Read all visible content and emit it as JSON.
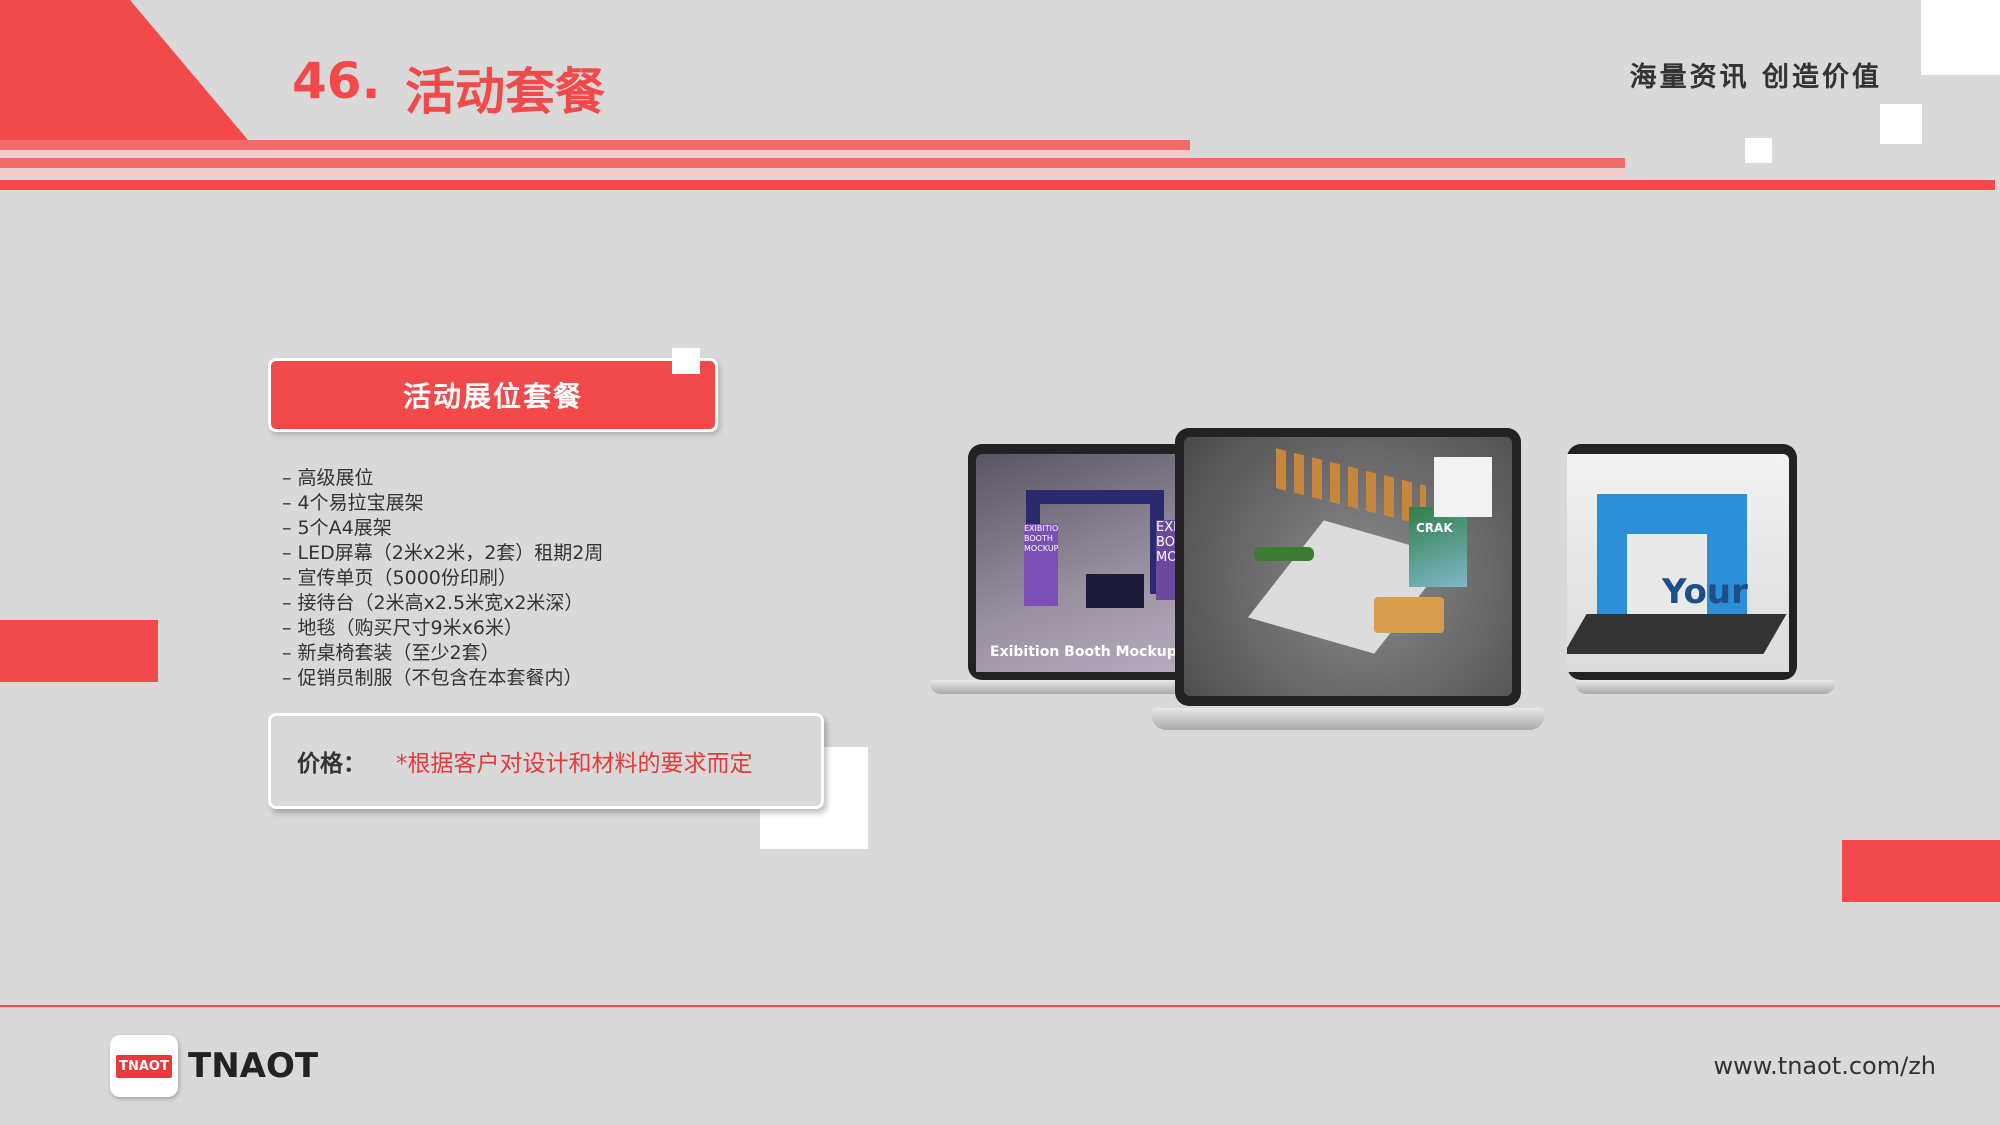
{
  "header": {
    "number": "46.",
    "title": "活动套餐",
    "tagline": "海量资讯 创造价值"
  },
  "package": {
    "button_label": "活动展位套餐",
    "features": [
      "高级展位",
      "4个易拉宝展架",
      "5个A4展架",
      "LED屏幕（2米x2米，2套）租期2周",
      "宣传单页（5000份印刷）",
      "接待台（2米高x2.5米宽x2米深）",
      "地毯（购买尺寸9米x6米）",
      "新桌椅套装（至少2套）",
      "促销员制服（不包含在本套餐内）"
    ],
    "price_label": "价格：",
    "price_note": "*根据客户对设计和材料的要求而定"
  },
  "mockup": {
    "left_screen_text": "Exibition Booth Mockup",
    "left_poster_text": "EXIBITION BOOTH MOCKUP",
    "left_sign_text": "EXIB BOO MOC",
    "center_brand": "CRAK",
    "right_booth_text": "Your"
  },
  "footer": {
    "logo_badge": "TNAOT",
    "logo_text": "TNAOT",
    "url": "www.tnaot.com/zh"
  },
  "colors": {
    "accent": "#f24a4a",
    "background": "#d9d9d9"
  }
}
